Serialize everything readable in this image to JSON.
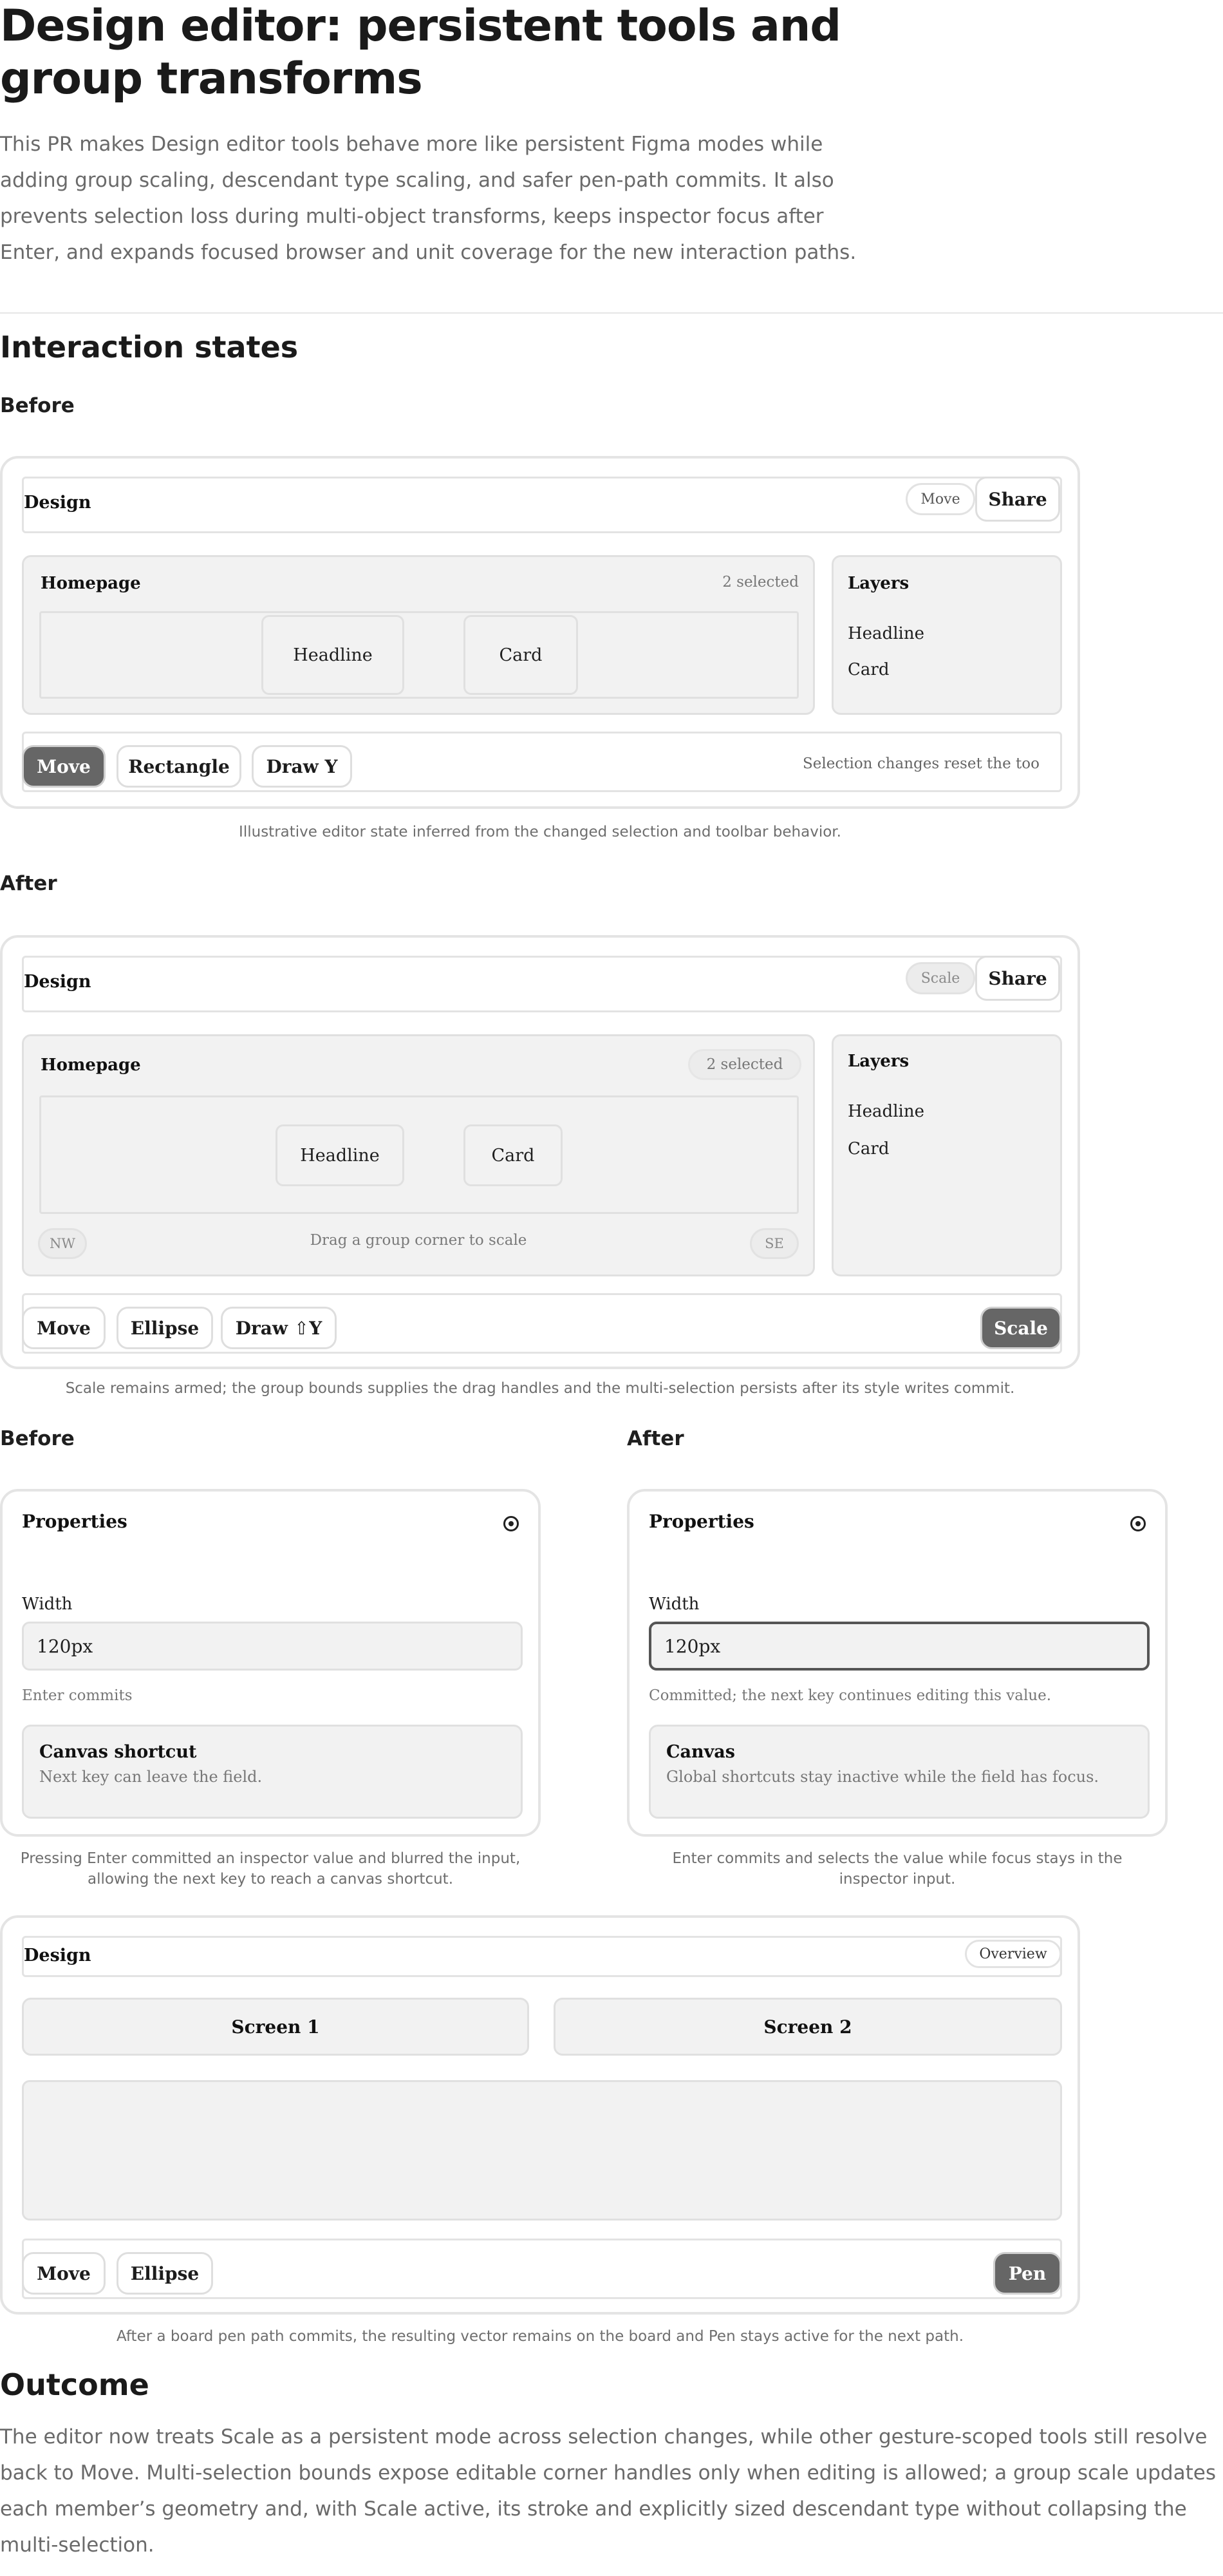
{
  "title": "Design editor: persistent tools and group transforms",
  "intro": "This PR makes Design editor tools behave more like persistent Figma modes while adding group scaling, descendant type scaling, and safer pen-path commits. It also prevents selection loss during multi-object transforms, keeps inspector focus after Enter, and expands focused browser and unit coverage for the new interaction paths.",
  "section_heading": "Interaction states",
  "before_label": "Before",
  "after_label": "After",
  "frame1": {
    "app_title": "Design",
    "mode_pill": "Move",
    "share": "Share",
    "board_title": "Homepage",
    "selected": "2 selected",
    "node_a": "Headline",
    "node_b": "Card",
    "layers_title": "Layers",
    "layers": [
      "Headline",
      "Card"
    ],
    "tools": [
      "Move",
      "Rectangle",
      "Draw Y"
    ],
    "status": "Selection changes reset the too",
    "caption": "Illustrative editor state inferred from the changed selection and toolbar behavior."
  },
  "frame2": {
    "app_title": "Design",
    "mode_pill": "Scale",
    "share": "Share",
    "board_title": "Homepage",
    "selected": "2 selected",
    "node_a": "Headline",
    "node_b": "Card",
    "handle_nw": "NW",
    "handle_se": "SE",
    "drag_hint": "Drag a group corner to scale",
    "layers_title": "Layers",
    "layers": [
      "Headline",
      "Card"
    ],
    "tools": [
      "Move",
      "Ellipse",
      "Draw ⇧Y"
    ],
    "active_tool": "Scale",
    "caption": "Scale remains armed; the group bounds supplies the drag handles and the multi-selection persists after its style writes commit."
  },
  "inspector_before": {
    "heading": "Before",
    "title": "Properties",
    "field_label": "Width",
    "field_value": "120px",
    "hint": "Enter commits",
    "note_title": "Canvas shortcut",
    "note_body": "Next key can leave the field.",
    "caption": "Pressing Enter committed an inspector value and blurred the input, allowing the next key to reach a canvas shortcut."
  },
  "inspector_after": {
    "heading": "After",
    "title": "Properties",
    "field_label": "Width",
    "field_value": "120px",
    "hint": "Committed; the next key continues editing this value.",
    "note_title": "Canvas",
    "note_body": "Global shortcuts stay inactive while the field has focus.",
    "caption": "Enter commits and selects the value while focus stays in the inspector input."
  },
  "frame3": {
    "app_title": "Design",
    "overview": "Overview",
    "screens": [
      "Screen 1",
      "Screen 2"
    ],
    "tools": [
      "Move",
      "Ellipse"
    ],
    "active_tool": "Pen",
    "caption": "After a board pen path commits, the resulting vector remains on the board and Pen stays active for the next path."
  },
  "outcome_heading": "Outcome",
  "outcome": "The editor now treats Scale as a persistent mode across selection changes, while other gesture-scoped tools still resolve back to Move. Multi-selection bounds expose editable corner handles only when editing is allowed; a group scale updates each member’s geometry and, with Scale active, its stroke and explicitly sized descendant type without collapsing the multi-selection."
}
